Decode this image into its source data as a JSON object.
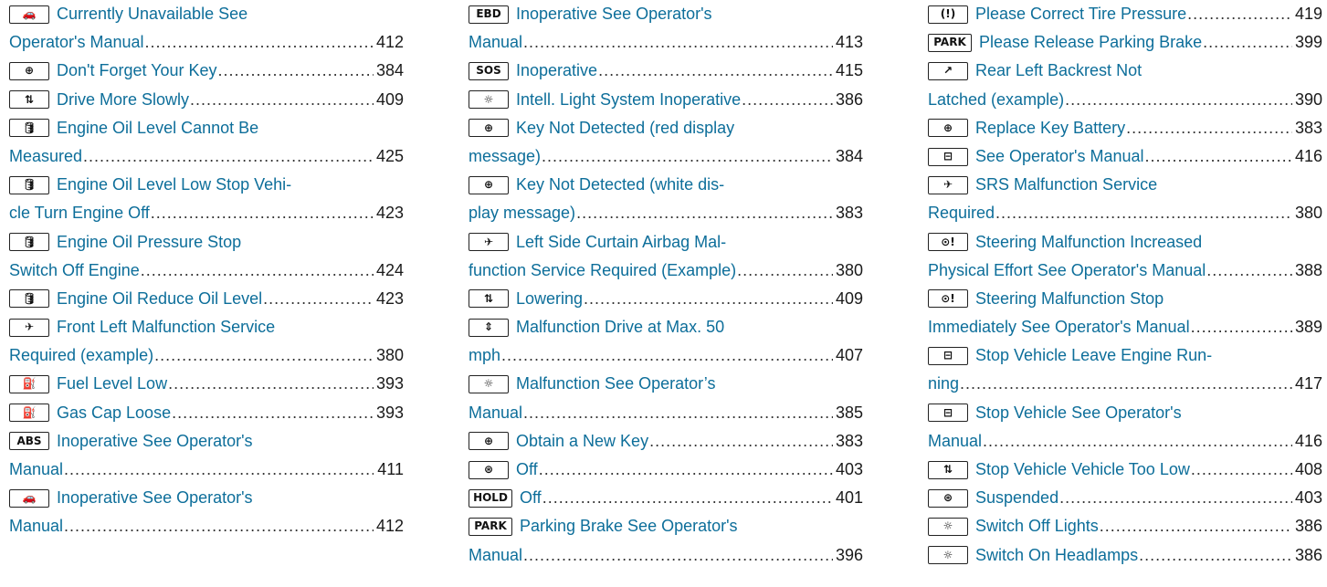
{
  "columns": [
    {
      "entries": [
        {
          "icon": "car-skid-icon",
          "glyph": "🚗",
          "line1": "Currently Unavailable See",
          "line2": "Operator's Manual",
          "page": "412"
        },
        {
          "icon": "key-icon",
          "glyph": "⊕",
          "line1": "Don't Forget Your Key",
          "page": "384"
        },
        {
          "icon": "car-level-icon",
          "glyph": "⇅",
          "line1": "Drive More Slowly",
          "page": "409"
        },
        {
          "icon": "oil-can-icon",
          "glyph": "🛢",
          "line1": "Engine Oil Level Cannot Be",
          "line2": "Measured",
          "page": "425"
        },
        {
          "icon": "oil-can-icon",
          "glyph": "🛢",
          "line1": "Engine Oil Level Low Stop Vehi-",
          "line2": "cle Turn Engine Off",
          "page": "423"
        },
        {
          "icon": "oil-can-icon",
          "glyph": "🛢",
          "line1": "Engine Oil Pressure Stop",
          "line2": "Switch Off Engine",
          "page": "424"
        },
        {
          "icon": "oil-can-icon",
          "glyph": "🛢",
          "line1": "Engine Oil Reduce Oil Level",
          "page": "423"
        },
        {
          "icon": "airbag-icon",
          "glyph": "✈",
          "line1": "Front Left Malfunction Service",
          "line2": "Required (example)",
          "page": "380"
        },
        {
          "icon": "fuel-pump-icon",
          "glyph": "⛽",
          "line1": "Fuel Level Low",
          "page": "393"
        },
        {
          "icon": "fuel-pump-icon",
          "glyph": "⛽",
          "line1": "Gas Cap Loose",
          "page": "393"
        },
        {
          "icon": "abs-icon",
          "glyph": "ABS",
          "line1": "Inoperative See Operator's",
          "line2": "Manual",
          "page": "411"
        },
        {
          "icon": "car-skid-icon",
          "glyph": "🚗",
          "line1": "Inoperative See Operator's",
          "line2": "Manual",
          "page": "412"
        }
      ]
    },
    {
      "entries": [
        {
          "icon": "ebd-icon",
          "glyph": "EBD",
          "line1": "Inoperative See Operator's",
          "line2": "Manual",
          "page": "413"
        },
        {
          "icon": "sos-icon",
          "glyph": "SOS",
          "line1": "Inoperative",
          "page": "415"
        },
        {
          "icon": "light-icon",
          "glyph": "☼",
          "line1": "Intell. Light System Inoperative",
          "page": "386"
        },
        {
          "icon": "key-icon",
          "glyph": "⊕",
          "line1": "Key Not Detected (red display",
          "line2": "message)",
          "page": "384"
        },
        {
          "icon": "key-icon",
          "glyph": "⊕",
          "line1": "Key Not Detected (white dis-",
          "line2": "play message)",
          "page": "383"
        },
        {
          "icon": "airbag-icon",
          "glyph": "✈",
          "line1": "Left Side Curtain Airbag Mal-",
          "line2": "function Service Required (Example)",
          "page": "380"
        },
        {
          "icon": "car-level-icon",
          "glyph": "⇅",
          "line1": "Lowering",
          "page": "409"
        },
        {
          "icon": "suspension-icon",
          "glyph": "⇕",
          "line1": "Malfunction Drive at Max. 50",
          "line2": "mph",
          "page": "407"
        },
        {
          "icon": "light-icon",
          "glyph": "☼",
          "line1": "Malfunction See Operator’s",
          "line2": "Manual",
          "page": "385"
        },
        {
          "icon": "key-icon",
          "glyph": "⊕",
          "line1": "Obtain a New Key",
          "page": "383"
        },
        {
          "icon": "hold-assist-icon",
          "glyph": "⊛",
          "line1": "Off",
          "page": "403"
        },
        {
          "icon": "hold-icon",
          "glyph": "HOLD",
          "line1": "Off",
          "page": "401"
        },
        {
          "icon": "park-icon",
          "glyph": "PARK",
          "line1": "Parking Brake See Operator's",
          "line2": "Manual",
          "page": "396"
        }
      ]
    },
    {
      "entries": [
        {
          "icon": "tire-pressure-icon",
          "glyph": "(!)",
          "line1": "Please Correct Tire Pressure",
          "page": "419"
        },
        {
          "icon": "park-icon",
          "glyph": "PARK",
          "line1": "Please Release Parking Brake",
          "page": "399"
        },
        {
          "icon": "backrest-icon",
          "glyph": "↗",
          "line1": "Rear Left Backrest Not",
          "line2": "Latched (example)",
          "page": "390"
        },
        {
          "icon": "key-icon",
          "glyph": "⊕",
          "line1": "Replace Key Battery",
          "page": "383"
        },
        {
          "icon": "battery-icon",
          "glyph": "⊟",
          "line1": "See Operator's Manual",
          "page": "416"
        },
        {
          "icon": "airbag-icon",
          "glyph": "✈",
          "line1": "SRS Malfunction Service",
          "line2": "Required",
          "page": "380"
        },
        {
          "icon": "steering-icon",
          "glyph": "⊙!",
          "line1": "Steering Malfunction Increased",
          "line2": "Physical Effort See Operator's Manual",
          "page": "388"
        },
        {
          "icon": "steering-icon",
          "glyph": "⊙!",
          "line1": "Steering Malfunction Stop",
          "line2": "Immediately See Operator's Manual",
          "page": "389"
        },
        {
          "icon": "battery-icon",
          "glyph": "⊟",
          "line1": "Stop Vehicle Leave Engine Run-",
          "line2": "ning",
          "page": "417"
        },
        {
          "icon": "battery-icon",
          "glyph": "⊟",
          "line1": "Stop Vehicle See Operator's",
          "line2": "Manual",
          "page": "416"
        },
        {
          "icon": "car-level-icon",
          "glyph": "⇅",
          "line1": "Stop Vehicle Vehicle Too Low",
          "page": "408"
        },
        {
          "icon": "hold-assist-icon",
          "glyph": "⊛",
          "line1": "Suspended",
          "page": "403"
        },
        {
          "icon": "light-icon",
          "glyph": "☼",
          "line1": "Switch Off Lights",
          "page": "386"
        },
        {
          "icon": "light-icon",
          "glyph": "☼",
          "line1": "Switch On Headlamps",
          "page": "386"
        }
      ]
    }
  ]
}
